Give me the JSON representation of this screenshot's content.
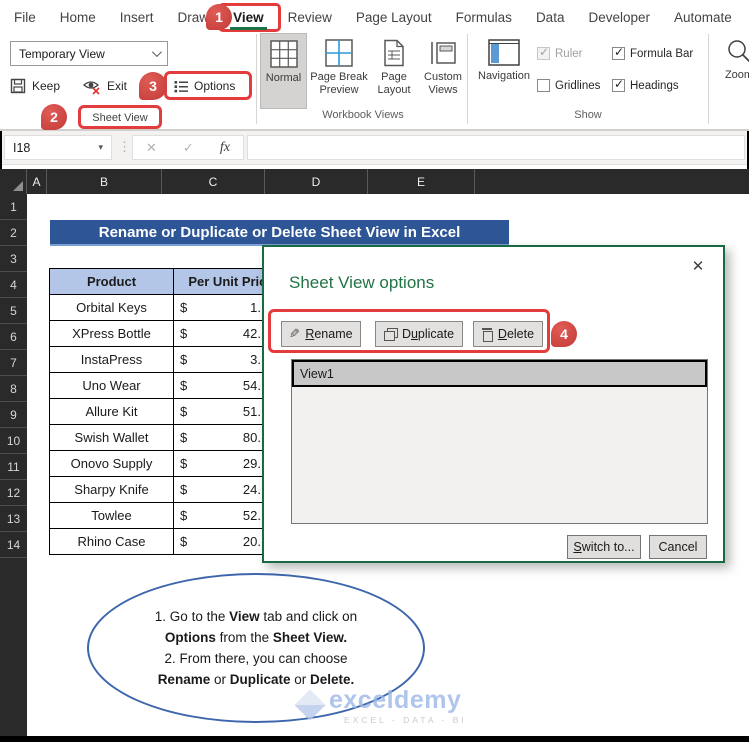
{
  "colors": {
    "accent_green": "#217346",
    "annotation_red": "#e23c3c",
    "title_bar_blue": "#2e5696",
    "table_header_blue": "#b4c6e7",
    "dark_header": "#2a2a2a"
  },
  "ribbon": {
    "tabs": [
      "File",
      "Home",
      "Insert",
      "Draw",
      "View",
      "Review",
      "Page Layout",
      "Formulas",
      "Data",
      "Developer",
      "Automate"
    ],
    "active_tab": "View",
    "sheet_view": {
      "combo_value": "Temporary View",
      "keep": "Keep",
      "exit": "Exit",
      "options": "Options",
      "label": "Sheet View"
    },
    "workbook_views": {
      "normal": "Normal",
      "page_break_preview": "Page Break Preview",
      "page_layout": "Page Layout",
      "custom_views": "Custom Views",
      "label": "Workbook Views"
    },
    "show": {
      "navigation": "Navigation",
      "ruler": "Ruler",
      "gridlines": "Gridlines",
      "formula_bar": "Formula Bar",
      "headings": "Headings",
      "label": "Show",
      "ruler_checked": true,
      "gridlines_checked": false,
      "formula_bar_checked": true,
      "headings_checked": true
    },
    "zoom": {
      "label": "Zoom"
    }
  },
  "annotations": {
    "step1": "1",
    "step2": "2",
    "step3": "3",
    "step4": "4"
  },
  "formula_bar": {
    "name_box": "I18",
    "fx_label": "fx"
  },
  "icons": {
    "close": "✕",
    "check": "✓",
    "cancel_x": "✕",
    "dots": "⋮",
    "dropdown_arrow": "▾",
    "pencil": "✎"
  },
  "sheet": {
    "cols": [
      "A",
      "B",
      "C",
      "D",
      "E"
    ],
    "rows": [
      "1",
      "2",
      "3",
      "4",
      "5",
      "6",
      "7",
      "8",
      "9",
      "10",
      "11",
      "12",
      "13",
      "14"
    ],
    "title": "Rename or Duplicate or Delete Sheet View in Excel",
    "table": {
      "col1": "Product",
      "col2": "Per Unit Price",
      "rows": [
        {
          "name": "Orbital Keys",
          "currency": "$",
          "price": "1."
        },
        {
          "name": "XPress Bottle",
          "currency": "$",
          "price": "42."
        },
        {
          "name": "InstaPress",
          "currency": "$",
          "price": "3."
        },
        {
          "name": "Uno Wear",
          "currency": "$",
          "price": "54."
        },
        {
          "name": "Allure Kit",
          "currency": "$",
          "price": "51."
        },
        {
          "name": "Swish Wallet",
          "currency": "$",
          "price": "80."
        },
        {
          "name": "Onovo Supply",
          "currency": "$",
          "price": "29."
        },
        {
          "name": "Sharpy Knife",
          "currency": "$",
          "price": "24."
        },
        {
          "name": "Towlee",
          "currency": "$",
          "price": "52."
        },
        {
          "name": "Rhino Case",
          "currency": "$",
          "price": "20."
        }
      ]
    },
    "note": {
      "l1a": "1. Go to the ",
      "l1b": "View",
      "l1c": " tab and click on",
      "l2a": "Options",
      "l2b": " from the ",
      "l2c": "Sheet View.",
      "l3": "2. From there, you can choose",
      "l4a": "Rename",
      "l4b": " or ",
      "l4c": "Duplicate",
      "l4d": " or ",
      "l4e": "Delete."
    },
    "watermark": {
      "brand": "exceldemy",
      "tagline": "EXCEL - DATA - BI"
    }
  },
  "dialog": {
    "title": "Sheet View options",
    "rename": {
      "accel": "R",
      "rest": "ename"
    },
    "duplicate": {
      "pre": "D",
      "accel": "u",
      "rest": "plicate"
    },
    "delete": {
      "accel": "D",
      "rest": "elete"
    },
    "list_items": [
      "View1"
    ],
    "switch_to": {
      "accel": "S",
      "rest": "witch to..."
    },
    "cancel": "Cancel"
  }
}
